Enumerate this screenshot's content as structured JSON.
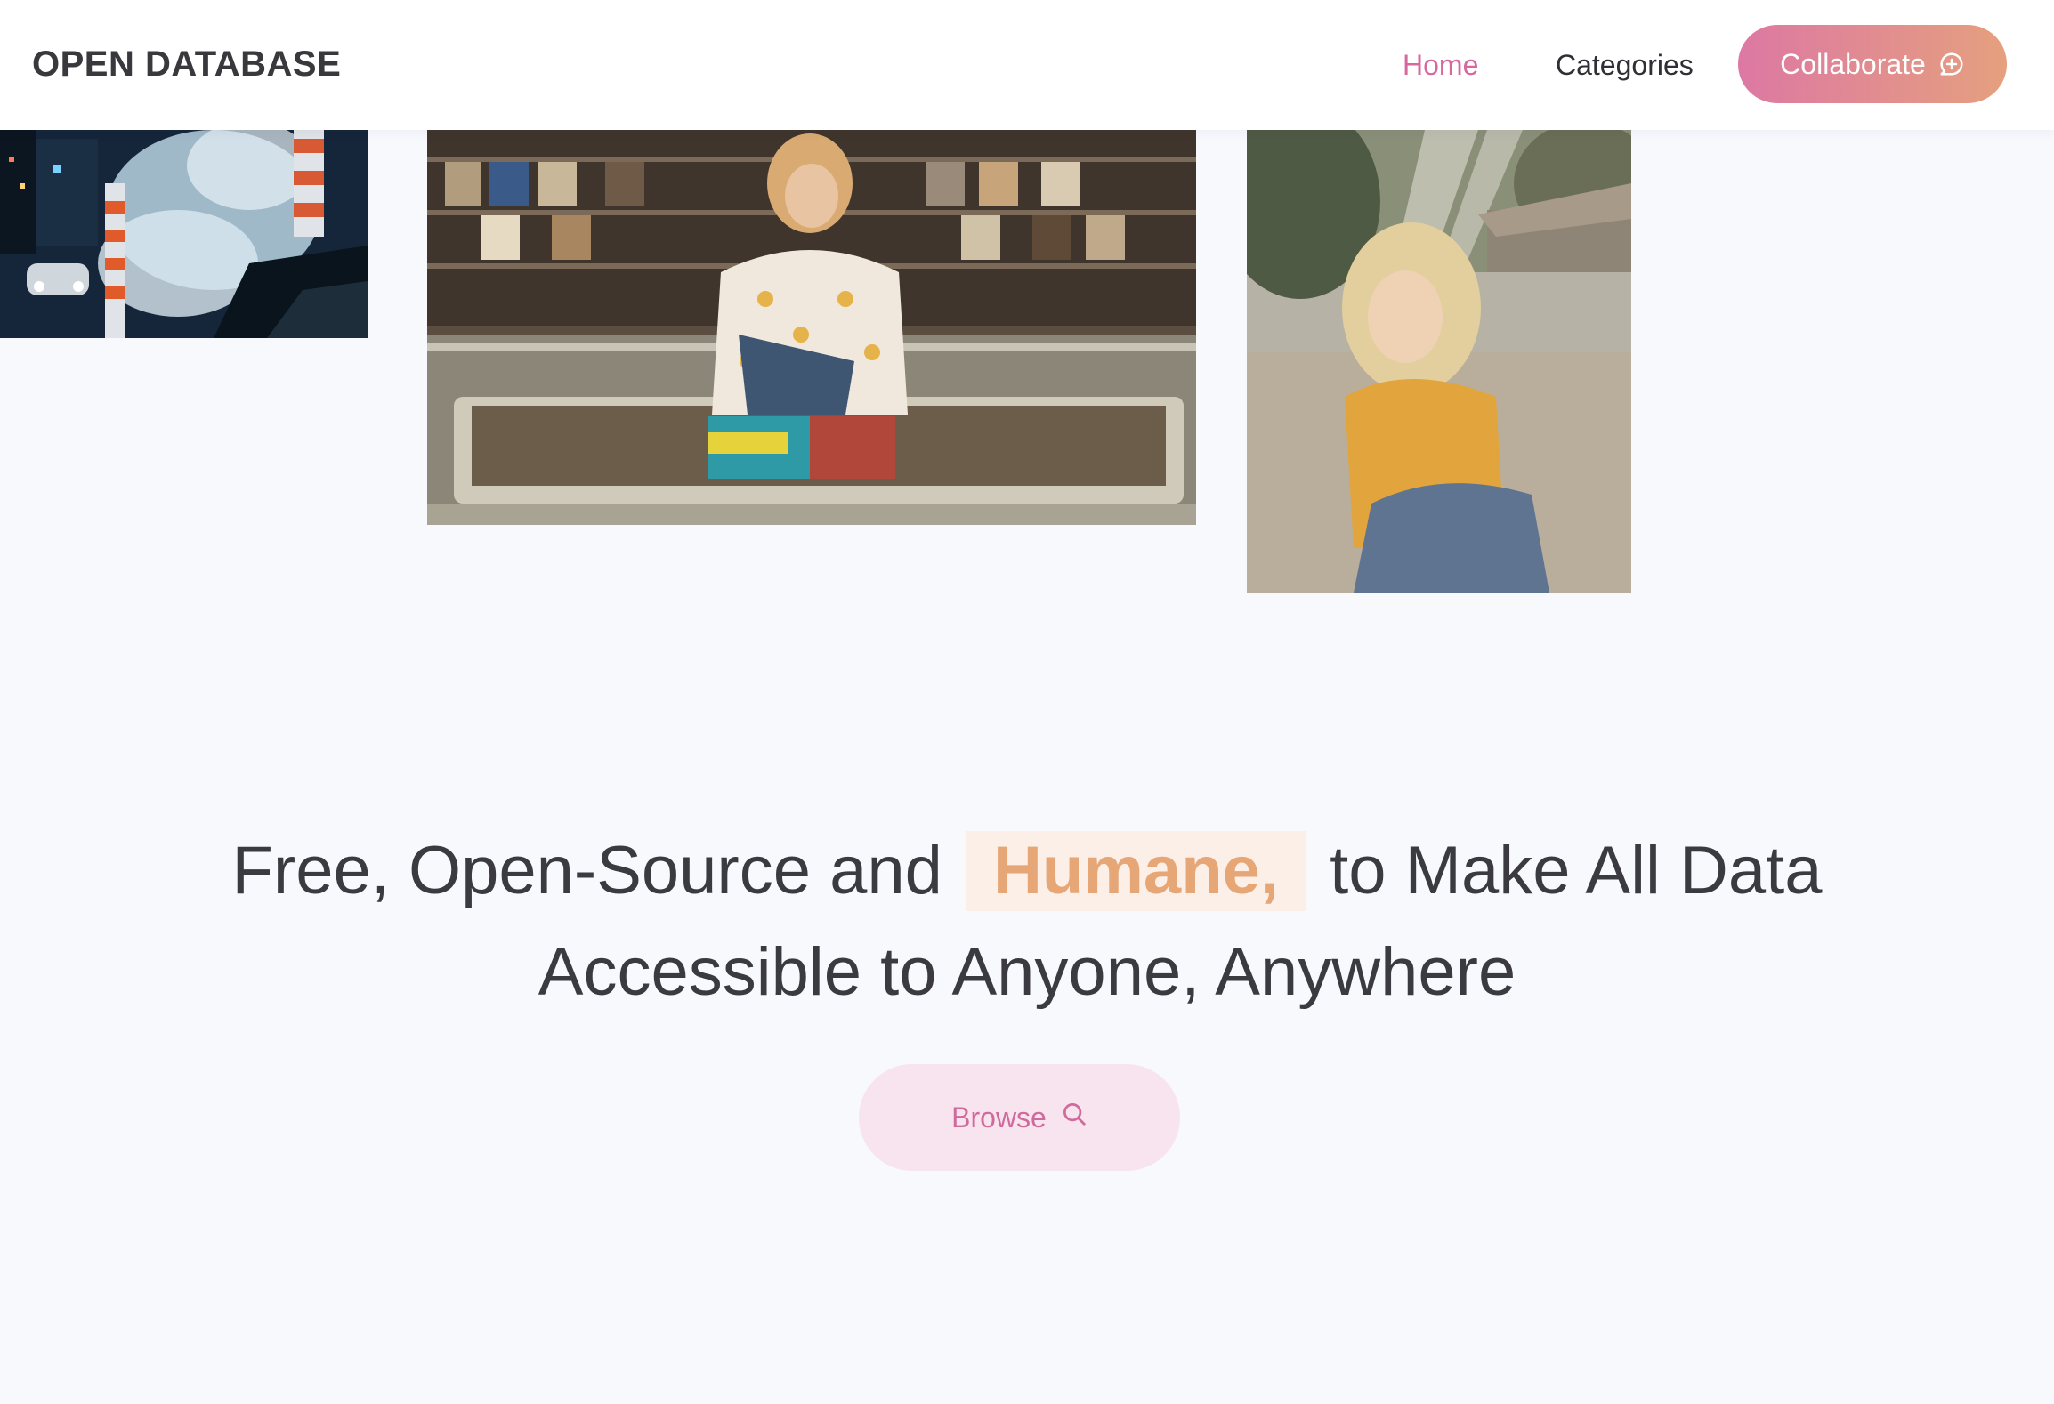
{
  "header": {
    "brand": "OPEN DATABASE",
    "nav": {
      "home": "Home",
      "categories": "Categories"
    },
    "cta_label": "Collaborate",
    "cta_icon": "chat-bubble-plus-icon"
  },
  "colors": {
    "accent_pink": "#d6689e",
    "accent_peach": "#e6a676",
    "gradient_start": "#dd78a3",
    "gradient_end": "#e5a07e",
    "highlight_bg": "#fbefe7",
    "browse_bg": "#f8e4ee",
    "page_bg": "#f8f9fd"
  },
  "hero": {
    "headline_before": "Free, Open-Source and",
    "headline_highlight": "Humane,",
    "headline_after_line1": "to Make All Data",
    "headline_line2": "Accessible to Anyone, Anywhere",
    "browse_label": "Browse",
    "browse_icon": "search-icon"
  }
}
